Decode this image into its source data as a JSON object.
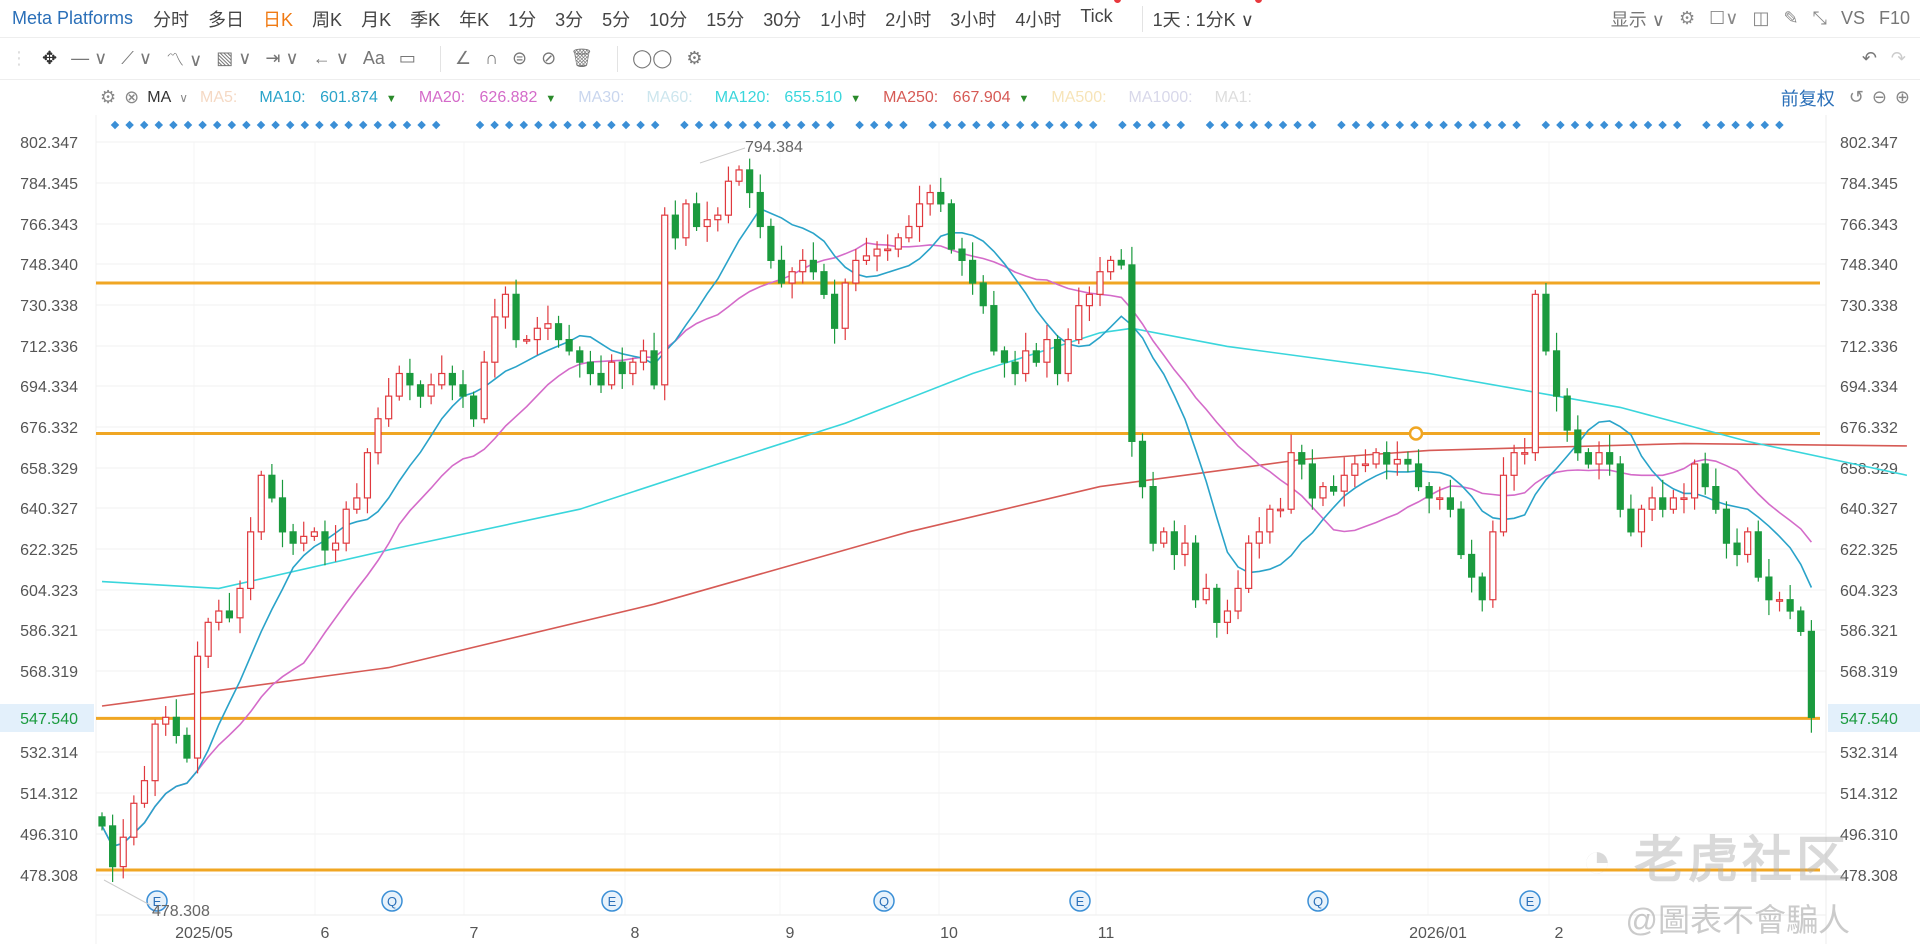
{
  "header": {
    "title": "Meta Platforms",
    "tabs": [
      "分时",
      "多日",
      "日K",
      "周K",
      "月K",
      "季K",
      "年K",
      "1分",
      "3分",
      "5分",
      "10分",
      "15分",
      "30分",
      "1小时",
      "2小时",
      "3小时",
      "4小时",
      "Tick"
    ],
    "active_tab": "日K",
    "range": "1天 : 1分K",
    "display": "显示",
    "vs": "VS",
    "f10": "F10"
  },
  "toolbar": {
    "text_tool": "Aa"
  },
  "indicator": {
    "name": "MA",
    "items": [
      {
        "label": "MA5:",
        "value": "",
        "color": "#f5d9c4"
      },
      {
        "label": "MA10:",
        "value": "601.874",
        "color": "#2aa3c9",
        "down": true
      },
      {
        "label": "MA20:",
        "value": "626.882",
        "color": "#d46bc9",
        "down": true
      },
      {
        "label": "MA30:",
        "value": "",
        "color": "#c9d6ee"
      },
      {
        "label": "MA60:",
        "value": "",
        "color": "#cde6ee"
      },
      {
        "label": "MA120:",
        "value": "655.510",
        "color": "#3ad6dc",
        "down": true
      },
      {
        "label": "MA250:",
        "value": "667.904",
        "color": "#d65a55",
        "down": true
      },
      {
        "label": "MA500:",
        "value": "",
        "color": "#f7e4b8"
      },
      {
        "label": "MA1000:",
        "value": "",
        "color": "#d8d8ea"
      },
      {
        "label": "MA1:",
        "value": "",
        "color": "#dddddd"
      }
    ],
    "adjust": "前复权"
  },
  "colors": {
    "up": "#e0393e",
    "down": "#1a9a3e",
    "level": "#f0a623",
    "accent": "#2a6fb8"
  },
  "chart_data": {
    "type": "candlestick",
    "yticks": [
      "802.347",
      "784.345",
      "766.343",
      "748.340",
      "730.338",
      "712.336",
      "694.334",
      "676.332",
      "658.329",
      "640.327",
      "622.325",
      "604.323",
      "586.321",
      "568.319",
      "547.540",
      "532.314",
      "514.312",
      "496.310",
      "478.308"
    ],
    "current_price": "547.540",
    "high_label": "794.384",
    "low_label": "478.308",
    "levels": [
      740,
      673.5,
      547.54,
      480.5
    ],
    "months": [
      "2025/05",
      "6",
      "7",
      "8",
      "9",
      "10",
      "11",
      "2026/01",
      "2"
    ],
    "events": [
      "E",
      "Q",
      "E",
      "Q",
      "E",
      "Q",
      "E"
    ],
    "closes": [
      500,
      482,
      495,
      510,
      520,
      545,
      548,
      540,
      530,
      575,
      590,
      595,
      592,
      605,
      630,
      655,
      645,
      630,
      625,
      628,
      630,
      622,
      625,
      640,
      645,
      665,
      680,
      690,
      700,
      695,
      690,
      695,
      700,
      695,
      690,
      680,
      705,
      725,
      735,
      715,
      715,
      720,
      722,
      715,
      710,
      705,
      700,
      695,
      705,
      700,
      705,
      710,
      695,
      770,
      760,
      775,
      765,
      768,
      770,
      785,
      790,
      780,
      765,
      750,
      740,
      745,
      750,
      745,
      735,
      720,
      740,
      750,
      752,
      755,
      755,
      760,
      765,
      775,
      780,
      775,
      755,
      750,
      740,
      730,
      710,
      705,
      700,
      710,
      705,
      715,
      700,
      715,
      730,
      735,
      745,
      750,
      748,
      670,
      650,
      625,
      630,
      620,
      625,
      600,
      605,
      590,
      595,
      605,
      625,
      630,
      640,
      640,
      665,
      660,
      645,
      650,
      648,
      655,
      660,
      660,
      665,
      660,
      662,
      660,
      650,
      645,
      645,
      640,
      620,
      610,
      600,
      630,
      655,
      665,
      665,
      735,
      710,
      690,
      675,
      665,
      660,
      665,
      660,
      640,
      630,
      640,
      645,
      640,
      645,
      645,
      660,
      650,
      640,
      625,
      620,
      630,
      610,
      600,
      600,
      595,
      586,
      548
    ],
    "ma120": [
      [
        0,
        608
      ],
      [
        11,
        605
      ],
      [
        27,
        622
      ],
      [
        45,
        640
      ],
      [
        58,
        660
      ],
      [
        70,
        678
      ],
      [
        82,
        700
      ],
      [
        94,
        718
      ],
      [
        97,
        720
      ],
      [
        106,
        712
      ],
      [
        125,
        700
      ],
      [
        143,
        685
      ],
      [
        155,
        670
      ],
      [
        170,
        655
      ]
    ],
    "ma250": [
      [
        0,
        553
      ],
      [
        27,
        570
      ],
      [
        52,
        598
      ],
      [
        76,
        630
      ],
      [
        94,
        650
      ],
      [
        113,
        662
      ],
      [
        125,
        666
      ],
      [
        149,
        669
      ],
      [
        170,
        668
      ]
    ]
  },
  "watermark": {
    "logo": "老虎社区",
    "author": "@圖表不會騙人"
  }
}
